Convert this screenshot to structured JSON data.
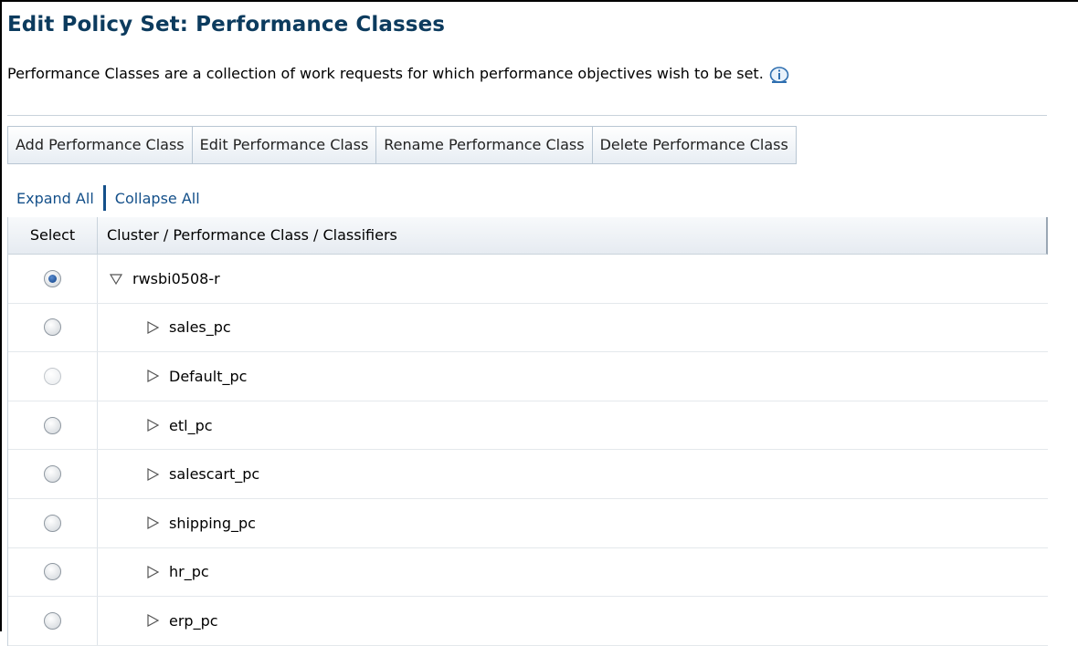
{
  "page": {
    "title": "Edit Policy Set: Performance Classes",
    "description": "Performance Classes are a collection of work requests for which performance objectives wish to be set.",
    "info_icon": "info-icon"
  },
  "toolbar": {
    "add_label": "Add Performance Class",
    "edit_label": "Edit Performance Class",
    "rename_label": "Rename Performance Class",
    "delete_label": "Delete Performance Class"
  },
  "tree_controls": {
    "expand_all": "Expand All",
    "collapse_all": "Collapse All"
  },
  "table": {
    "headers": {
      "select": "Select",
      "name": "Cluster / Performance Class / Classifiers"
    },
    "rows": [
      {
        "label": "rwsbi0508-r",
        "selected": true,
        "expanded": true,
        "level": 0
      },
      {
        "label": "sales_pc",
        "selected": false,
        "expanded": false,
        "level": 1
      },
      {
        "label": "Default_pc",
        "selected": false,
        "expanded": false,
        "level": 1,
        "disabled": true
      },
      {
        "label": "etl_pc",
        "selected": false,
        "expanded": false,
        "level": 1
      },
      {
        "label": "salescart_pc",
        "selected": false,
        "expanded": false,
        "level": 1
      },
      {
        "label": "shipping_pc",
        "selected": false,
        "expanded": false,
        "level": 1
      },
      {
        "label": "hr_pc",
        "selected": false,
        "expanded": false,
        "level": 1
      },
      {
        "label": "erp_pc",
        "selected": false,
        "expanded": false,
        "level": 1
      }
    ]
  },
  "colors": {
    "title": "#0c3b5e",
    "link": "#14508a"
  }
}
